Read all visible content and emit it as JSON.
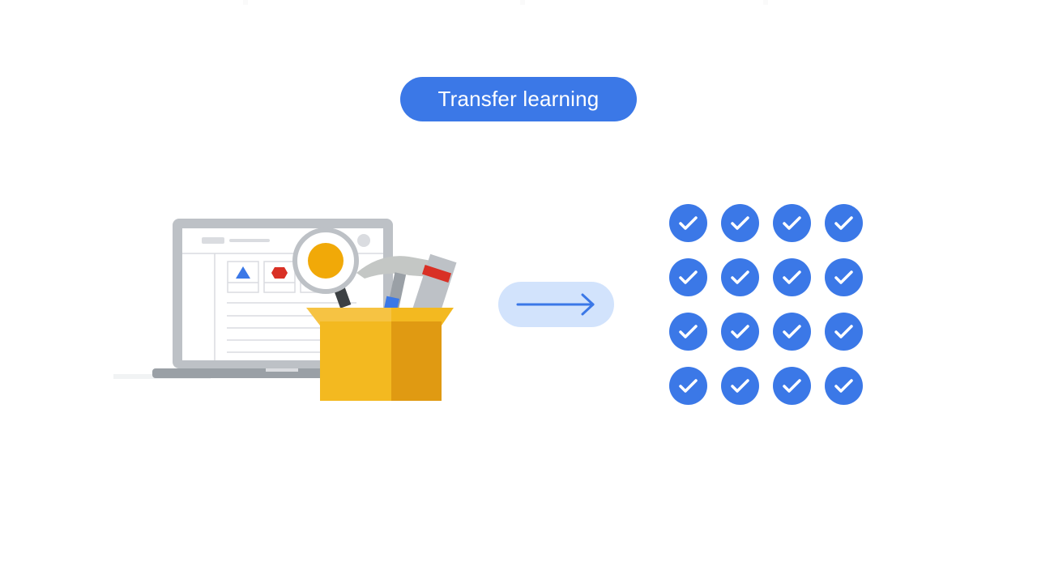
{
  "title": "Transfer learning",
  "colors": {
    "accent": "#3b78e7",
    "arrow_bg": "#d2e3fc",
    "arrow": "#3b78e7",
    "box_light": "#f3b920",
    "box_dark": "#e09a12",
    "laptop_frame": "#bdc1c6",
    "triangle": "#3b78e7",
    "hexagon": "#d93025",
    "lens": "#f1a908"
  },
  "illustration": {
    "label": "laptop-with-toolbox",
    "icons": [
      "laptop-icon",
      "magnifier-icon",
      "hammer-icon",
      "screwdriver-icon",
      "box-icon"
    ]
  },
  "arrow": {
    "icon": "arrow-right-icon"
  },
  "results": {
    "rows": 4,
    "cols": 4,
    "items": [
      "check",
      "check",
      "check",
      "check",
      "check",
      "check",
      "check",
      "check",
      "check",
      "check",
      "check",
      "check",
      "check",
      "check",
      "check",
      "check"
    ]
  }
}
